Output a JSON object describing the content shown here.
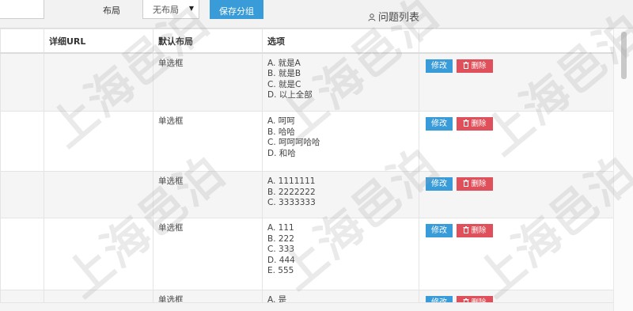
{
  "toolbar": {
    "layout_label": "布局",
    "layout_select_value": "无布局",
    "save_group_label": "保存分组",
    "panel_title": "问题列表"
  },
  "table": {
    "headers": [
      "详细URL",
      "默认布局",
      "选项"
    ],
    "rows": [
      {
        "layout": "单选框",
        "options": [
          "A. 就是A",
          "B. 就是B",
          "C. 就是C",
          "D. 以上全部"
        ],
        "edit_label": "修改",
        "delete_label": "删除"
      },
      {
        "layout": "单选框",
        "options": [
          "A. 呵呵",
          "B. 哈哈",
          "C. 呵呵呵哈哈",
          "D. 和哈"
        ],
        "edit_label": "修改",
        "delete_label": "删除"
      },
      {
        "layout": "单选框",
        "options": [
          "A. 1111111",
          "B. 2222222",
          "C. 3333333"
        ],
        "edit_label": "修改",
        "delete_label": "删除"
      },
      {
        "layout": "单选框",
        "options": [
          "A. 111",
          "B. 222",
          "C. 333",
          "D. 444",
          "E. 555"
        ],
        "edit_label": "修改",
        "delete_label": "删除"
      },
      {
        "layout": "单选框",
        "options": [
          "A. 是"
        ],
        "edit_label": "修改",
        "delete_label": "删除"
      }
    ]
  },
  "watermark": "上海邑泊",
  "colors": {
    "primary": "#3a9bd9",
    "danger": "#e0505a"
  }
}
